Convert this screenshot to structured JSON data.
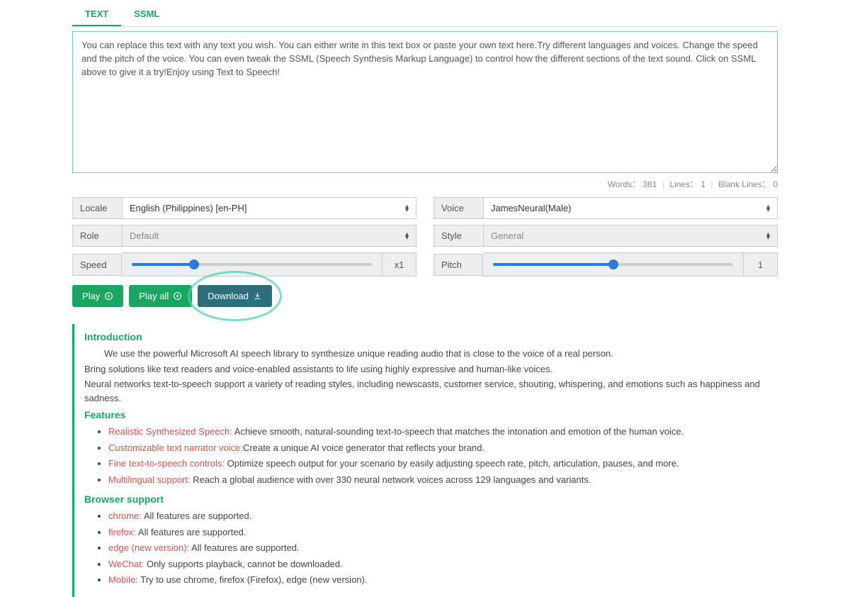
{
  "tabs": {
    "text": "TEXT",
    "ssml": "SSML"
  },
  "textarea": {
    "value": "You can replace this text with any text you wish. You can either write in this text box or paste your own text here.Try different languages and voices. Change the speed and the pitch of the voice. You can even tweak the SSML (Speech Synthesis Markup Language) to control how the different sections of the text sound. Click on SSML above to give it a try!Enjoy using Text to Speech!"
  },
  "stats": {
    "words_label": "Words：",
    "words": "381",
    "lines_label": "Lines：",
    "lines": "1",
    "blank_label": "Blank Lines：",
    "blank": "0"
  },
  "locale": {
    "label": "Locale",
    "value": "English (Philippines) [en-PH]"
  },
  "role": {
    "label": "Role",
    "value": "Default"
  },
  "voice": {
    "label": "Voice",
    "value": "JamesNeural(Male)"
  },
  "style": {
    "label": "Style",
    "value": "General"
  },
  "speed": {
    "label": "Speed",
    "value_display": "x1"
  },
  "pitch": {
    "label": "Pitch",
    "value_display": "1"
  },
  "buttons": {
    "play": "Play",
    "play_all": "Play all",
    "download": "Download"
  },
  "intro": {
    "heading": "Introduction",
    "p1": "We use the powerful Microsoft AI speech library to synthesize unique reading audio that is close to the voice of a real person.",
    "p2": "Bring solutions like text readers and voice-enabled assistants to life using highly expressive and human-like voices.",
    "p3": "Neural networks text-to-speech support a variety of reading styles, including newscasts, customer service, shouting, whispering, and emotions such as happiness and sadness."
  },
  "features": {
    "heading": "Features",
    "items": [
      {
        "hl": "Realistic Synthesized Speech:",
        "text": " Achieve smooth, natural-sounding text-to-speech that matches the intonation and emotion of the human voice."
      },
      {
        "hl": "Customizable text narrator voice:",
        "text": "Create a unique AI voice generator that reflects your brand."
      },
      {
        "hl": "Fine text-to-speech controls:",
        "text": " Optimize speech output for your scenario by easily adjusting speech rate, pitch, articulation, pauses, and more."
      },
      {
        "hl": "Multilingual support:",
        "text": " Reach a global audience with over 330 neural network voices across 129 languages and variants."
      }
    ]
  },
  "browser": {
    "heading": "Browser support",
    "items": [
      {
        "hl": "chrome:",
        "text": " All features are supported."
      },
      {
        "hl": "firefox:",
        "text": " All features are supported."
      },
      {
        "hl": "edge (new version):",
        "text": " All features are supported."
      },
      {
        "hl": "WeChat:",
        "text": " Only supports playback, cannot be downloaded."
      },
      {
        "hl": "Mobile:",
        "text": " Try to use chrome, firefox (Firefox), edge (new version)."
      }
    ]
  }
}
